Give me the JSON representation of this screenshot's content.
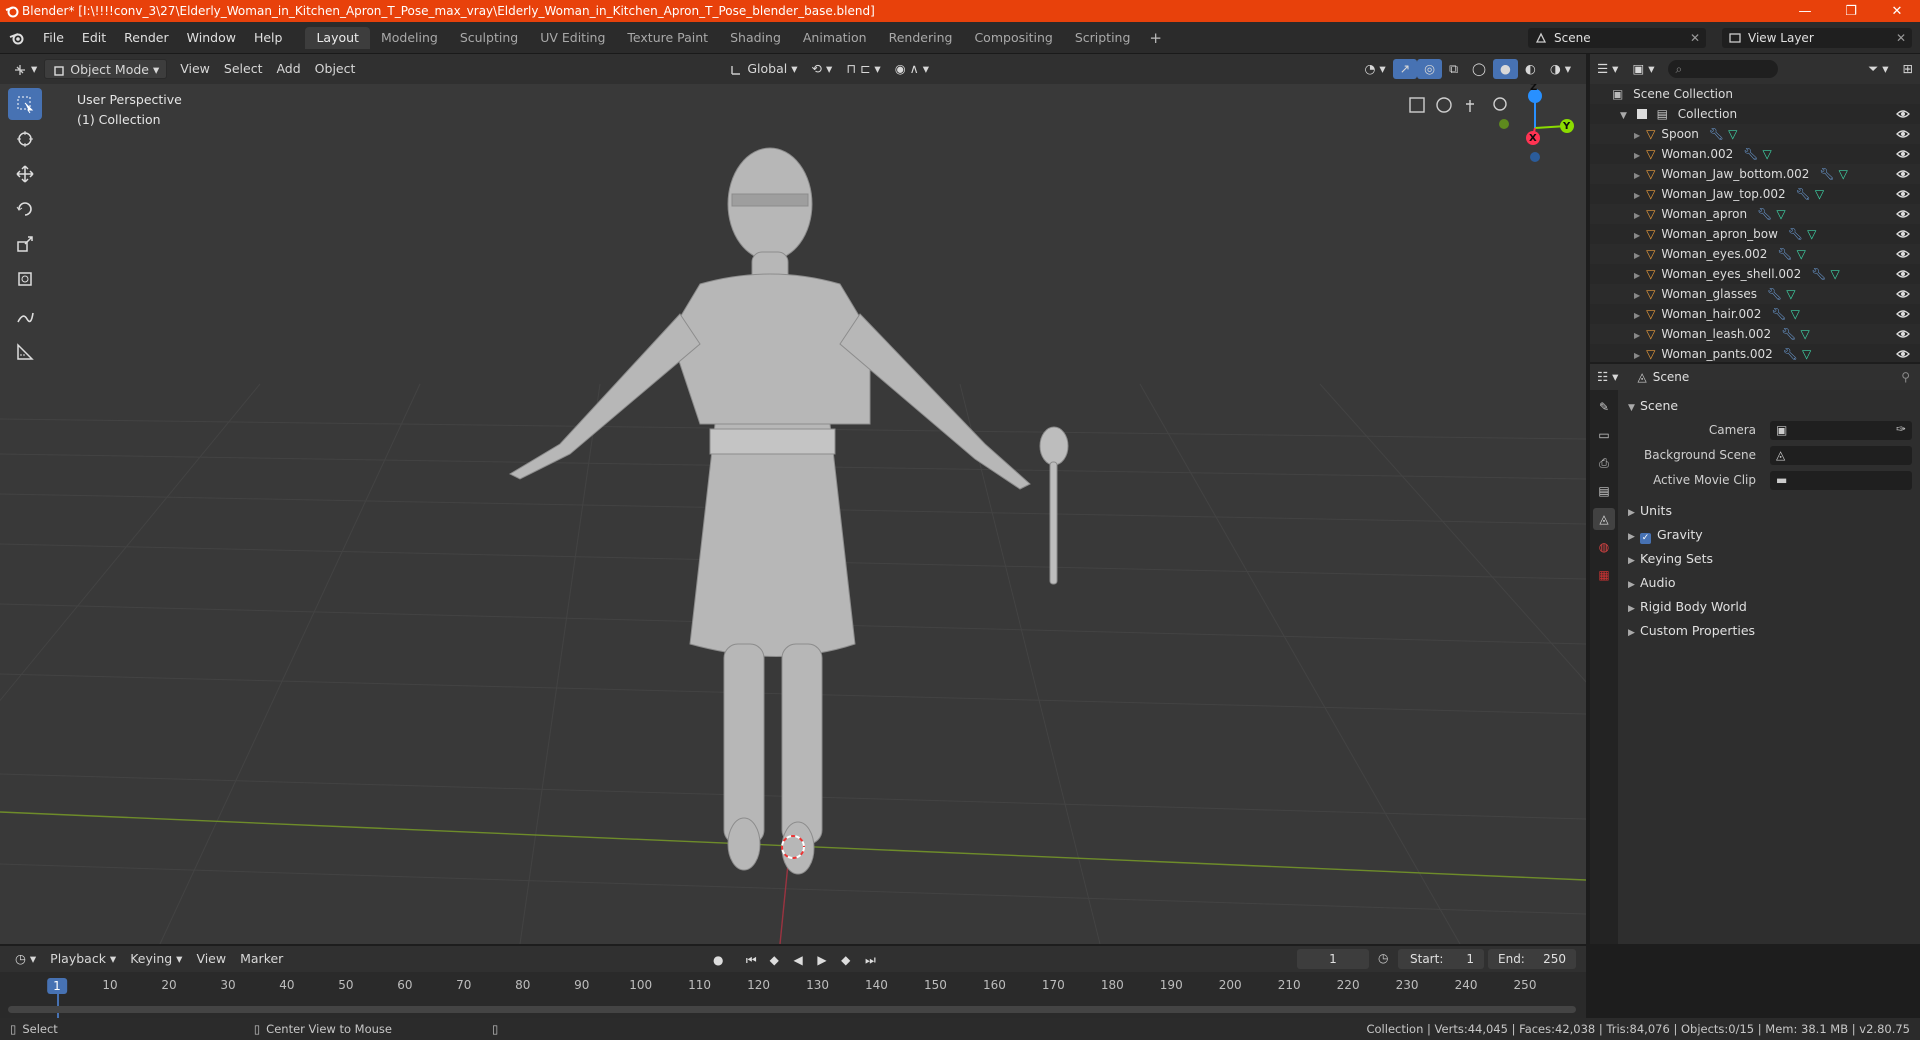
{
  "window": {
    "title": "Blender* [I:\\!!!!conv_3\\27\\Elderly_Woman_in_Kitchen_Apron_T_Pose_max_vray\\Elderly_Woman_in_Kitchen_Apron_T_Pose_blender_base.blend]",
    "minimize": "—",
    "restore": "❐",
    "close": "✕"
  },
  "menu": [
    "File",
    "Edit",
    "Render",
    "Window",
    "Help"
  ],
  "workspaces": [
    "Layout",
    "Modeling",
    "Sculpting",
    "UV Editing",
    "Texture Paint",
    "Shading",
    "Animation",
    "Rendering",
    "Compositing",
    "Scripting"
  ],
  "scene_selector": "Scene",
  "view_layer_selector": "View Layer",
  "viewport_header": {
    "mode": "Object Mode",
    "menus": [
      "View",
      "Select",
      "Add",
      "Object"
    ],
    "transform_orientation": "Global"
  },
  "viewport": {
    "perspective_label": "User Perspective",
    "collection_label": "(1) Collection",
    "gizmo": {
      "z": "Z",
      "y": "Y",
      "x": "X"
    }
  },
  "outliner": {
    "root": "Scene Collection",
    "collection": "Collection",
    "objects": [
      "Spoon",
      "Woman.002",
      "Woman_Jaw_bottom.002",
      "Woman_Jaw_top.002",
      "Woman_apron",
      "Woman_apron_bow",
      "Woman_eyes.002",
      "Woman_eyes_shell.002",
      "Woman_glasses",
      "Woman_hair.002",
      "Woman_leash.002",
      "Woman_pants.002"
    ]
  },
  "properties": {
    "header_title": "Scene",
    "section_title": "Scene",
    "camera_label": "Camera",
    "background_scene_label": "Background Scene",
    "active_movie_clip_label": "Active Movie Clip",
    "panels": [
      "Units",
      "Gravity",
      "Keying Sets",
      "Audio",
      "Rigid Body World",
      "Custom Properties"
    ]
  },
  "timeline": {
    "menus": [
      "Playback",
      "Keying",
      "View",
      "Marker"
    ],
    "current_frame": "1",
    "start_label": "Start:",
    "start": "1",
    "end_label": "End:",
    "end": "250",
    "ruler": [
      "1",
      "10",
      "20",
      "30",
      "40",
      "50",
      "60",
      "70",
      "80",
      "90",
      "100",
      "110",
      "120",
      "130",
      "140",
      "150",
      "160",
      "170",
      "180",
      "190",
      "200",
      "210",
      "220",
      "230",
      "240",
      "250"
    ]
  },
  "status": {
    "left": "Select",
    "middle": "Center View to Mouse",
    "right": "Collection | Verts:44,045 | Faces:42,038 | Tris:84,076 | Objects:0/15 | Mem: 38.1 MB | v2.80.75"
  },
  "colors": {
    "titlebar": "#e8410b",
    "accent_blue": "#4772b3",
    "axis_x": "#ff3352",
    "axis_y": "#8bdc00",
    "axis_z": "#2890ff",
    "mesh_icon": "#e69a3c",
    "modifier_icon": "#6e9fd9",
    "data_icon": "#3fd6a8"
  }
}
